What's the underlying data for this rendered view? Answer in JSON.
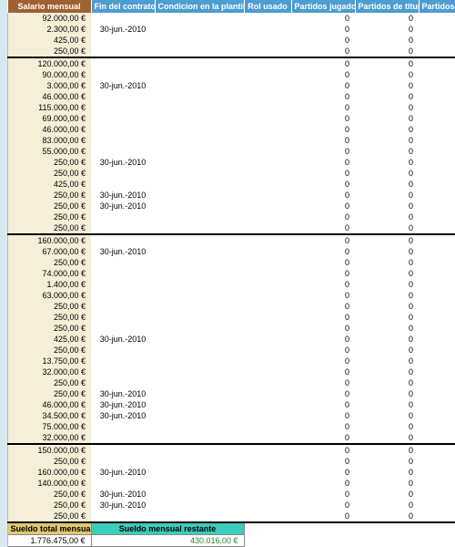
{
  "headers": {
    "salary": "Salario mensual",
    "contract": "Fin del contrato",
    "condition": "Condicion en la plantilla",
    "role": "Rol usado",
    "played": "Partidos jugados",
    "starter": "Partidos de titular",
    "sub": "Partidos en"
  },
  "groups": [
    {
      "rows": [
        {
          "salary": "92.000,00 €",
          "contract": ""
        },
        {
          "salary": "2.300,00 €",
          "contract": "30-jun.-2010"
        },
        {
          "salary": "425,00 €",
          "contract": ""
        },
        {
          "salary": "250,00 €",
          "contract": ""
        }
      ]
    },
    {
      "rows": [
        {
          "salary": "120.000,00 €",
          "contract": ""
        },
        {
          "salary": "90.000,00 €",
          "contract": ""
        },
        {
          "salary": "3.000,00 €",
          "contract": "30-jun.-2010"
        },
        {
          "salary": "46.000,00 €",
          "contract": ""
        },
        {
          "salary": "115.000,00 €",
          "contract": ""
        },
        {
          "salary": "69.000,00 €",
          "contract": ""
        },
        {
          "salary": "46.000,00 €",
          "contract": ""
        },
        {
          "salary": "83.000,00 €",
          "contract": ""
        },
        {
          "salary": "55.000,00 €",
          "contract": ""
        },
        {
          "salary": "250,00 €",
          "contract": "30-jun.-2010"
        },
        {
          "salary": "250,00 €",
          "contract": ""
        },
        {
          "salary": "425,00 €",
          "contract": ""
        },
        {
          "salary": "250,00 €",
          "contract": "30-jun.-2010"
        },
        {
          "salary": "250,00 €",
          "contract": "30-jun.-2010"
        },
        {
          "salary": "250,00 €",
          "contract": ""
        },
        {
          "salary": "250,00 €",
          "contract": ""
        }
      ]
    },
    {
      "rows": [
        {
          "salary": "160.000,00 €",
          "contract": ""
        },
        {
          "salary": "67.000,00 €",
          "contract": "30-jun.-2010"
        },
        {
          "salary": "250,00 €",
          "contract": ""
        },
        {
          "salary": "74.000,00 €",
          "contract": ""
        },
        {
          "salary": "1.400,00 €",
          "contract": ""
        },
        {
          "salary": "63.000,00 €",
          "contract": ""
        },
        {
          "salary": "250,00 €",
          "contract": ""
        },
        {
          "salary": "250,00 €",
          "contract": ""
        },
        {
          "salary": "250,00 €",
          "contract": ""
        },
        {
          "salary": "425,00 €",
          "contract": "30-jun.-2010"
        },
        {
          "salary": "250,00 €",
          "contract": ""
        },
        {
          "salary": "13.750,00 €",
          "contract": ""
        },
        {
          "salary": "32.000,00 €",
          "contract": ""
        },
        {
          "salary": "250,00 €",
          "contract": ""
        },
        {
          "salary": "250,00 €",
          "contract": "30-jun.-2010"
        },
        {
          "salary": "46.000,00 €",
          "contract": "30-jun.-2010"
        },
        {
          "salary": "34.500,00 €",
          "contract": "30-jun.-2010"
        },
        {
          "salary": "75.000,00 €",
          "contract": ""
        },
        {
          "salary": "32.000,00 €",
          "contract": ""
        }
      ]
    },
    {
      "rows": [
        {
          "salary": "150.000,00 €",
          "contract": ""
        },
        {
          "salary": "250,00 €",
          "contract": ""
        },
        {
          "salary": "160.000,00 €",
          "contract": "30-jun.-2010"
        },
        {
          "salary": "140.000,00 €",
          "contract": ""
        },
        {
          "salary": "250,00 €",
          "contract": "30-jun.-2010"
        },
        {
          "salary": "250,00 €",
          "contract": "30-jun.-2010"
        },
        {
          "salary": "250,00 €",
          "contract": ""
        }
      ]
    }
  ],
  "zero": "0",
  "footer": {
    "total_label": "Sueldo total mensual",
    "total_value": "1.776.475,00 €",
    "remain_label": "Sueldo mensual restante",
    "remain_value": "430.016,00 €"
  }
}
